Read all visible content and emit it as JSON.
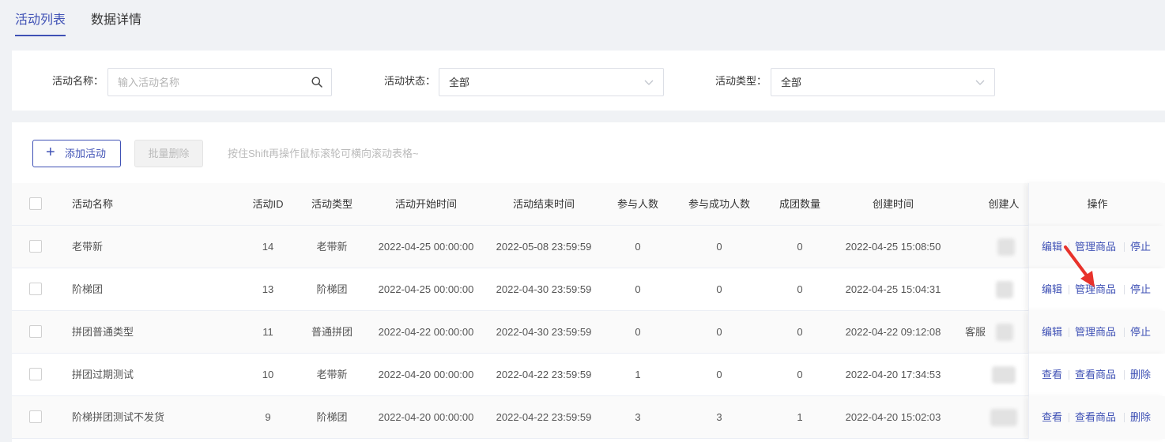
{
  "tabs": [
    {
      "label": "活动列表"
    },
    {
      "label": "数据详情"
    }
  ],
  "filters": {
    "name_label": "活动名称：",
    "name_placeholder": "输入活动名称",
    "status_label": "活动状态：",
    "status_value": "全部",
    "type_label": "活动类型：",
    "type_value": "全部"
  },
  "toolbar": {
    "add_label": "添加活动",
    "batch_delete_label": "批量删除",
    "hint": "按住Shift再操作鼠标滚轮可横向滚动表格~"
  },
  "table": {
    "headers": {
      "name": "活动名称",
      "id": "活动ID",
      "type": "活动类型",
      "start": "活动开始时间",
      "end": "活动结束时间",
      "participants": "参与人数",
      "success": "参与成功人数",
      "groups": "成团数量",
      "created": "创建时间",
      "creator": "创建人",
      "ops": "操作"
    },
    "rows": [
      {
        "name": "老带新",
        "id": "14",
        "type": "老带新",
        "start": "2022-04-25 00:00:00",
        "end": "2022-05-08 23:59:59",
        "participants": "0",
        "success": "0",
        "groups": "0",
        "created": "2022-04-25 15:08:50",
        "creator": "",
        "op1": "编辑",
        "op2": "管理商品",
        "op3": "停止"
      },
      {
        "name": "阶梯团",
        "id": "13",
        "type": "阶梯团",
        "start": "2022-04-25 00:00:00",
        "end": "2022-04-30 23:59:59",
        "participants": "0",
        "success": "0",
        "groups": "0",
        "created": "2022-04-25 15:04:31",
        "creator": "",
        "op1": "编辑",
        "op2": "管理商品",
        "op3": "停止"
      },
      {
        "name": "拼团普通类型",
        "id": "11",
        "type": "普通拼团",
        "start": "2022-04-22 00:00:00",
        "end": "2022-04-30 23:59:59",
        "participants": "0",
        "success": "0",
        "groups": "0",
        "created": "2022-04-22 09:12:08",
        "creator": "客服",
        "op1": "编辑",
        "op2": "管理商品",
        "op3": "停止"
      },
      {
        "name": "拼团过期测试",
        "id": "10",
        "type": "老带新",
        "start": "2022-04-20 00:00:00",
        "end": "2022-04-22 23:59:59",
        "participants": "1",
        "success": "0",
        "groups": "0",
        "created": "2022-04-20 17:34:53",
        "creator": "",
        "op1": "查看",
        "op2": "查看商品",
        "op3": "删除"
      },
      {
        "name": "阶梯拼团测试不发货",
        "id": "9",
        "type": "阶梯团",
        "start": "2022-04-20 00:00:00",
        "end": "2022-04-22 23:59:59",
        "participants": "3",
        "success": "3",
        "groups": "1",
        "created": "2022-04-20 15:02:03",
        "creator": "",
        "op1": "查看",
        "op2": "查看商品",
        "op3": "删除"
      }
    ]
  },
  "colors": {
    "accent": "#3f51b5",
    "annotation_arrow": "#e8322b"
  }
}
